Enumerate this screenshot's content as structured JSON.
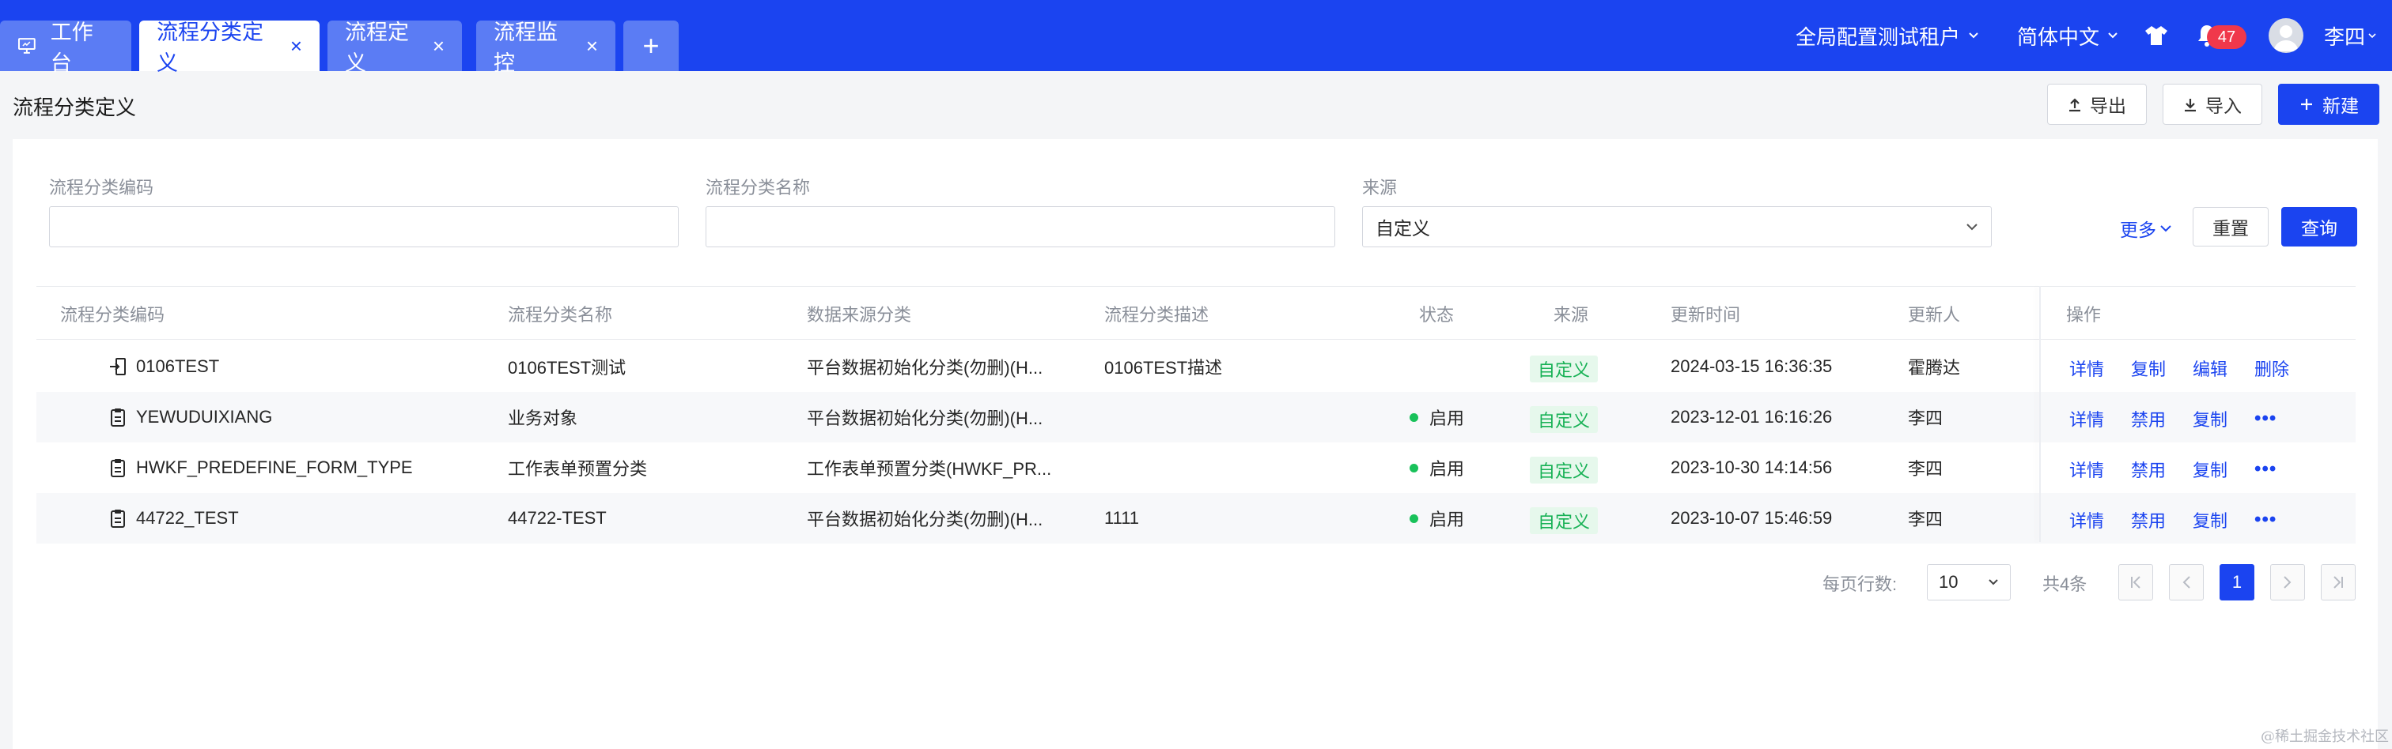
{
  "tabs": [
    {
      "label": "工作台"
    },
    {
      "label": "流程分类定义"
    },
    {
      "label": "流程定义"
    },
    {
      "label": "流程监控"
    }
  ],
  "topbar": {
    "tenant": "全局配置测试租户",
    "language": "简体中文",
    "notification_count": "47",
    "user_name": "李四"
  },
  "page": {
    "title": "流程分类定义",
    "export_label": "导出",
    "import_label": "导入",
    "new_label": "新建"
  },
  "filters": {
    "code_label": "流程分类编码",
    "code_value": "",
    "name_label": "流程分类名称",
    "name_value": "",
    "source_label": "来源",
    "source_value": "自定义",
    "more_label": "更多",
    "reset_label": "重置",
    "query_label": "查询"
  },
  "table": {
    "columns": [
      "流程分类编码",
      "流程分类名称",
      "数据来源分类",
      "流程分类描述",
      "状态",
      "来源",
      "更新时间",
      "更新人",
      "操作"
    ],
    "rows": [
      {
        "code": "0106TEST",
        "name": "0106TEST测试",
        "data_source": "平台数据初始化分类(勿删)(H...",
        "desc": "0106TEST描述",
        "status": "",
        "source": "自定义",
        "updated": "2024-03-15 16:36:35",
        "updater": "霍腾达",
        "ops": [
          "详情",
          "复制",
          "编辑",
          "删除"
        ],
        "icon": "enter-icon"
      },
      {
        "code": "YEWUDUIXIANG",
        "name": "业务对象",
        "data_source": "平台数据初始化分类(勿删)(H...",
        "desc": "",
        "status": "启用",
        "source": "自定义",
        "updated": "2023-12-01 16:16:26",
        "updater": "李四",
        "ops": [
          "详情",
          "禁用",
          "复制"
        ],
        "icon": "clipboard-icon"
      },
      {
        "code": "HWKF_PREDEFINE_FORM_TYPE",
        "name": "工作表单预置分类",
        "data_source": "工作表单预置分类(HWKF_PR...",
        "desc": "",
        "status": "启用",
        "source": "自定义",
        "updated": "2023-10-30 14:14:56",
        "updater": "李四",
        "ops": [
          "详情",
          "禁用",
          "复制"
        ],
        "icon": "clipboard-icon"
      },
      {
        "code": "44722_TEST",
        "name": "44722-TEST",
        "data_source": "平台数据初始化分类(勿删)(H...",
        "desc": "1111",
        "status": "启用",
        "source": "自定义",
        "updated": "2023-10-07 15:46:59",
        "updater": "李四",
        "ops": [
          "详情",
          "禁用",
          "复制"
        ],
        "icon": "clipboard-icon"
      }
    ]
  },
  "pagination": {
    "rows_per_page_label": "每页行数:",
    "page_size": "10",
    "total": "共4条",
    "current_page": "1"
  },
  "watermark": "@稀土掘金技术社区",
  "colors": {
    "brand": "#1b44f0",
    "success": "#19c15a",
    "tag_bg": "#e6f8ec",
    "badge": "#f0384b"
  }
}
